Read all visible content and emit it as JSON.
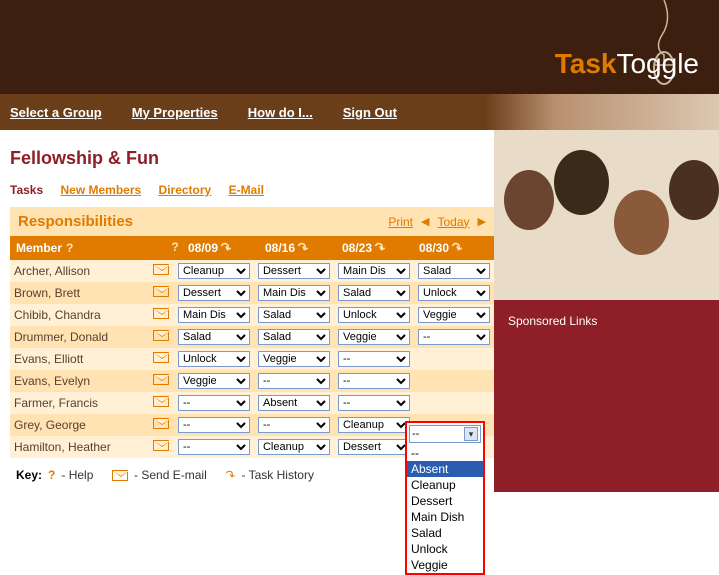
{
  "brand": {
    "part1": "Task",
    "part2": "Toggle"
  },
  "nav": {
    "select_group": "Select a Group",
    "my_properties": "My Properties",
    "how_do_i": "How do I...",
    "sign_out": "Sign Out"
  },
  "page": {
    "title": "Fellowship & Fun"
  },
  "subnav": {
    "tasks": "Tasks",
    "new_members": "New Members",
    "directory": "Directory",
    "email": "E-Mail"
  },
  "section": {
    "title": "Responsibilities",
    "print": "Print",
    "today": "Today"
  },
  "columns": {
    "member": "Member",
    "dates": [
      "08/09",
      "08/16",
      "08/23",
      "08/30"
    ]
  },
  "task_options": [
    "--",
    "Absent",
    "Cleanup",
    "Dessert",
    "Main Dish",
    "Salad",
    "Unlock",
    "Veggie"
  ],
  "rows": [
    {
      "name": "Archer, Allison",
      "tasks": [
        "Cleanup",
        "Dessert",
        "Main Dish",
        "Salad"
      ]
    },
    {
      "name": "Brown, Brett",
      "tasks": [
        "Dessert",
        "Main Dish",
        "Salad",
        "Unlock"
      ]
    },
    {
      "name": "Chibib, Chandra",
      "tasks": [
        "Main Dish",
        "Salad",
        "Unlock",
        "Veggie"
      ]
    },
    {
      "name": "Drummer, Donald",
      "tasks": [
        "Salad",
        "Salad",
        "Veggie",
        "--"
      ]
    },
    {
      "name": "Evans, Elliott",
      "tasks": [
        "Unlock",
        "Veggie",
        "--",
        "--"
      ]
    },
    {
      "name": "Evans, Evelyn",
      "tasks": [
        "Veggie",
        "--",
        "--",
        ""
      ]
    },
    {
      "name": "Farmer, Francis",
      "tasks": [
        "--",
        "Absent",
        "--",
        ""
      ]
    },
    {
      "name": "Grey, George",
      "tasks": [
        "--",
        "--",
        "Cleanup",
        ""
      ]
    },
    {
      "name": "Hamilton, Heather",
      "tasks": [
        "--",
        "Cleanup",
        "Dessert",
        ""
      ]
    }
  ],
  "open_dropdown": {
    "row": 4,
    "col": 3,
    "current": "--",
    "options": [
      "--",
      "Absent",
      "Cleanup",
      "Dessert",
      "Main Dish",
      "Salad",
      "Unlock",
      "Veggie"
    ],
    "highlighted": "Absent"
  },
  "key": {
    "label": "Key:",
    "help": "- Help",
    "send_email": "- Send E-mail",
    "task_history": "- Task History"
  },
  "sidebar": {
    "sponsored": "Sponsored Links"
  }
}
